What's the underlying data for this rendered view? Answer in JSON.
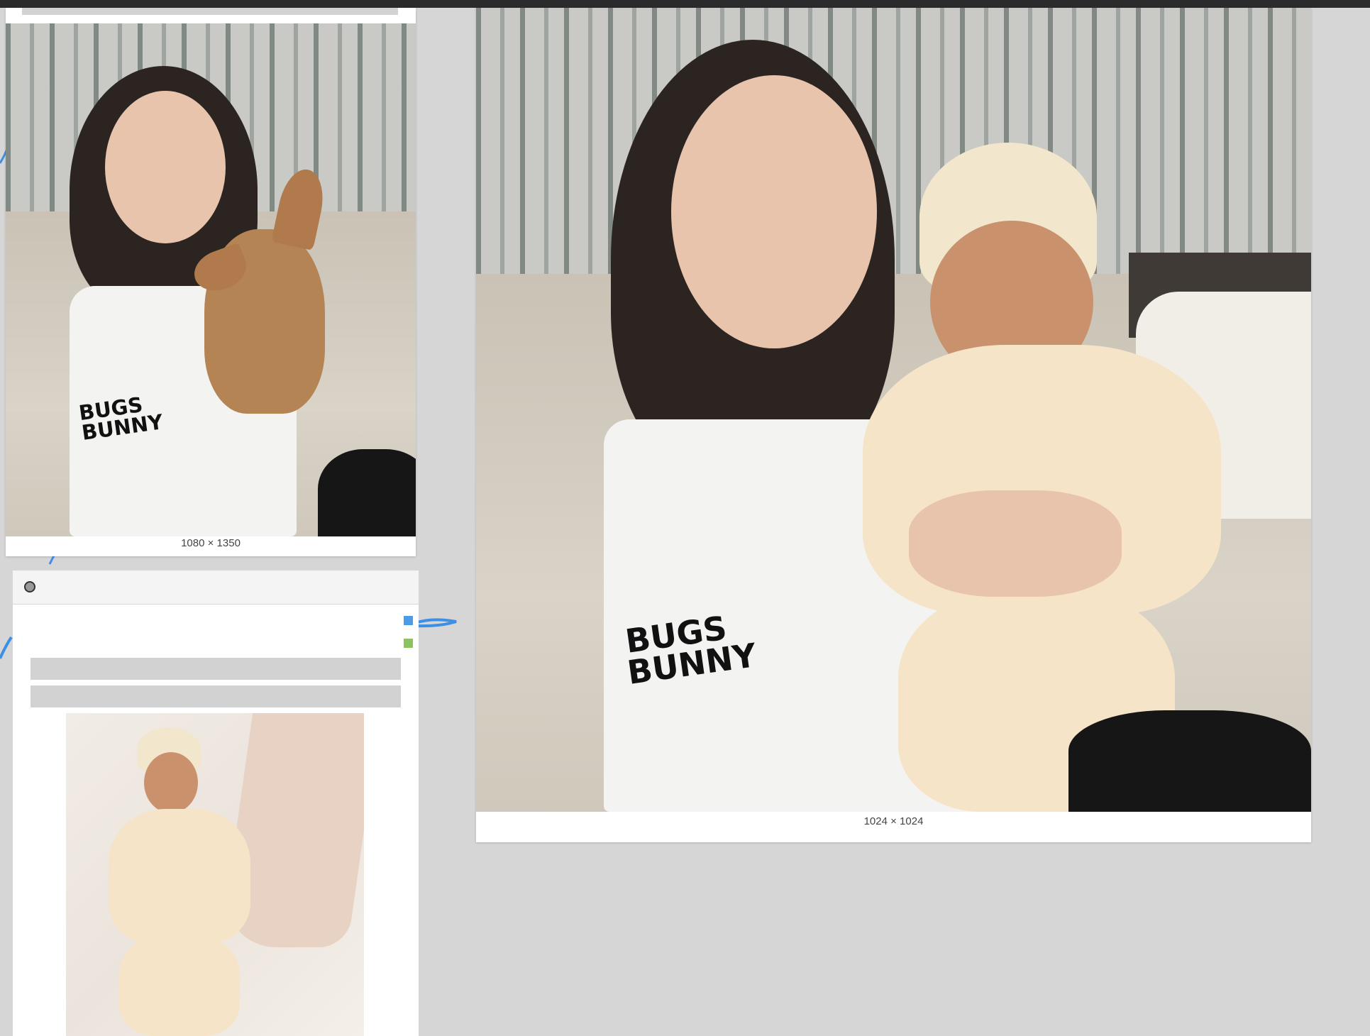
{
  "canvas": {
    "nodes": [
      {
        "id": "portrait-dog",
        "caption": "1080 × 1350"
      },
      {
        "id": "portrait-baby",
        "caption": "1024 × 1024",
        "sleeve_text": "BUGS BUNNY"
      }
    ],
    "input_panel": {
      "port_colors": [
        "#4a9ce8",
        "#8cc260"
      ]
    }
  },
  "colors": {
    "canvas_bg": "#d6d6d6",
    "wire": "#3d8fe6",
    "topbar": "#2b2b2b"
  }
}
